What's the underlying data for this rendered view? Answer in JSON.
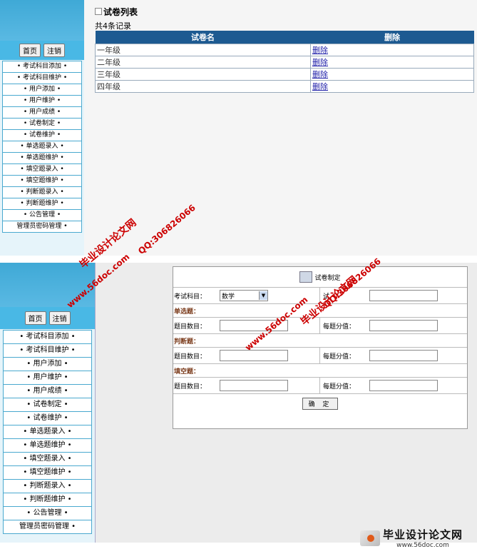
{
  "top_panel": {
    "nav_buttons": [
      "首页",
      "注销"
    ],
    "menu": [
      "• 考试科目添加 •",
      "• 考试科目维护 •",
      "• 用户添加 •",
      "• 用户维护 •",
      "• 用户成绩 •",
      "• 试卷制定 •",
      "• 试卷维护 •",
      "• 单选题录入 •",
      "• 单选题维护 •",
      "• 填空题录入 •",
      "• 填空题维护 •",
      "• 判断题录入 •",
      "• 判断题维护 •",
      "• 公告管理 •",
      "管理员密码管理 •"
    ],
    "title": "试卷列表",
    "count": "共4条记录",
    "table": {
      "headers": [
        "试卷名",
        "删除"
      ],
      "rows": [
        [
          "一年级",
          "删除"
        ],
        [
          "二年级",
          "删除"
        ],
        [
          "三年级",
          "删除"
        ],
        [
          "四年级",
          "删除"
        ]
      ]
    }
  },
  "bottom_panel": {
    "nav_buttons": [
      "首页",
      "注销"
    ],
    "menu": [
      "• 考试科目添加 •",
      "• 考试科目维护 •",
      "• 用户添加 •",
      "• 用户维护 •",
      "• 用户成绩 •",
      "• 试卷制定 •",
      "• 试卷维护 •",
      "• 单选题录入 •",
      "• 单选题维护 •",
      "• 填空题录入 •",
      "• 填空题维护 •",
      "• 判断题录入 •",
      "• 判断题维护 •",
      "• 公告管理 •",
      "管理员密码管理 •"
    ],
    "form": {
      "header": "试卷制定",
      "subject_label": "考试科目：",
      "subject_value": "数学",
      "second_label": "试",
      "sections": [
        {
          "title": "单选题：",
          "count_label": "题目数目：",
          "score_label": "每题分值："
        },
        {
          "title": "判断题：",
          "count_label": "题目数目：",
          "score_label": "每题分值："
        },
        {
          "title": "填空题：",
          "count_label": "题目数目：",
          "score_label": "每题分值："
        }
      ],
      "confirm": "确 定"
    }
  },
  "watermarks": {
    "site_name": "毕业设计论文网",
    "qq": "QQ:306826066",
    "url": "www.56doc.com"
  },
  "logo": {
    "text": "毕业设计论文网",
    "url": "www.56doc.com"
  },
  "colors": {
    "sidebar_accent": "#49b8e5",
    "table_header": "#1d5a91",
    "watermark": "#cc0000"
  }
}
